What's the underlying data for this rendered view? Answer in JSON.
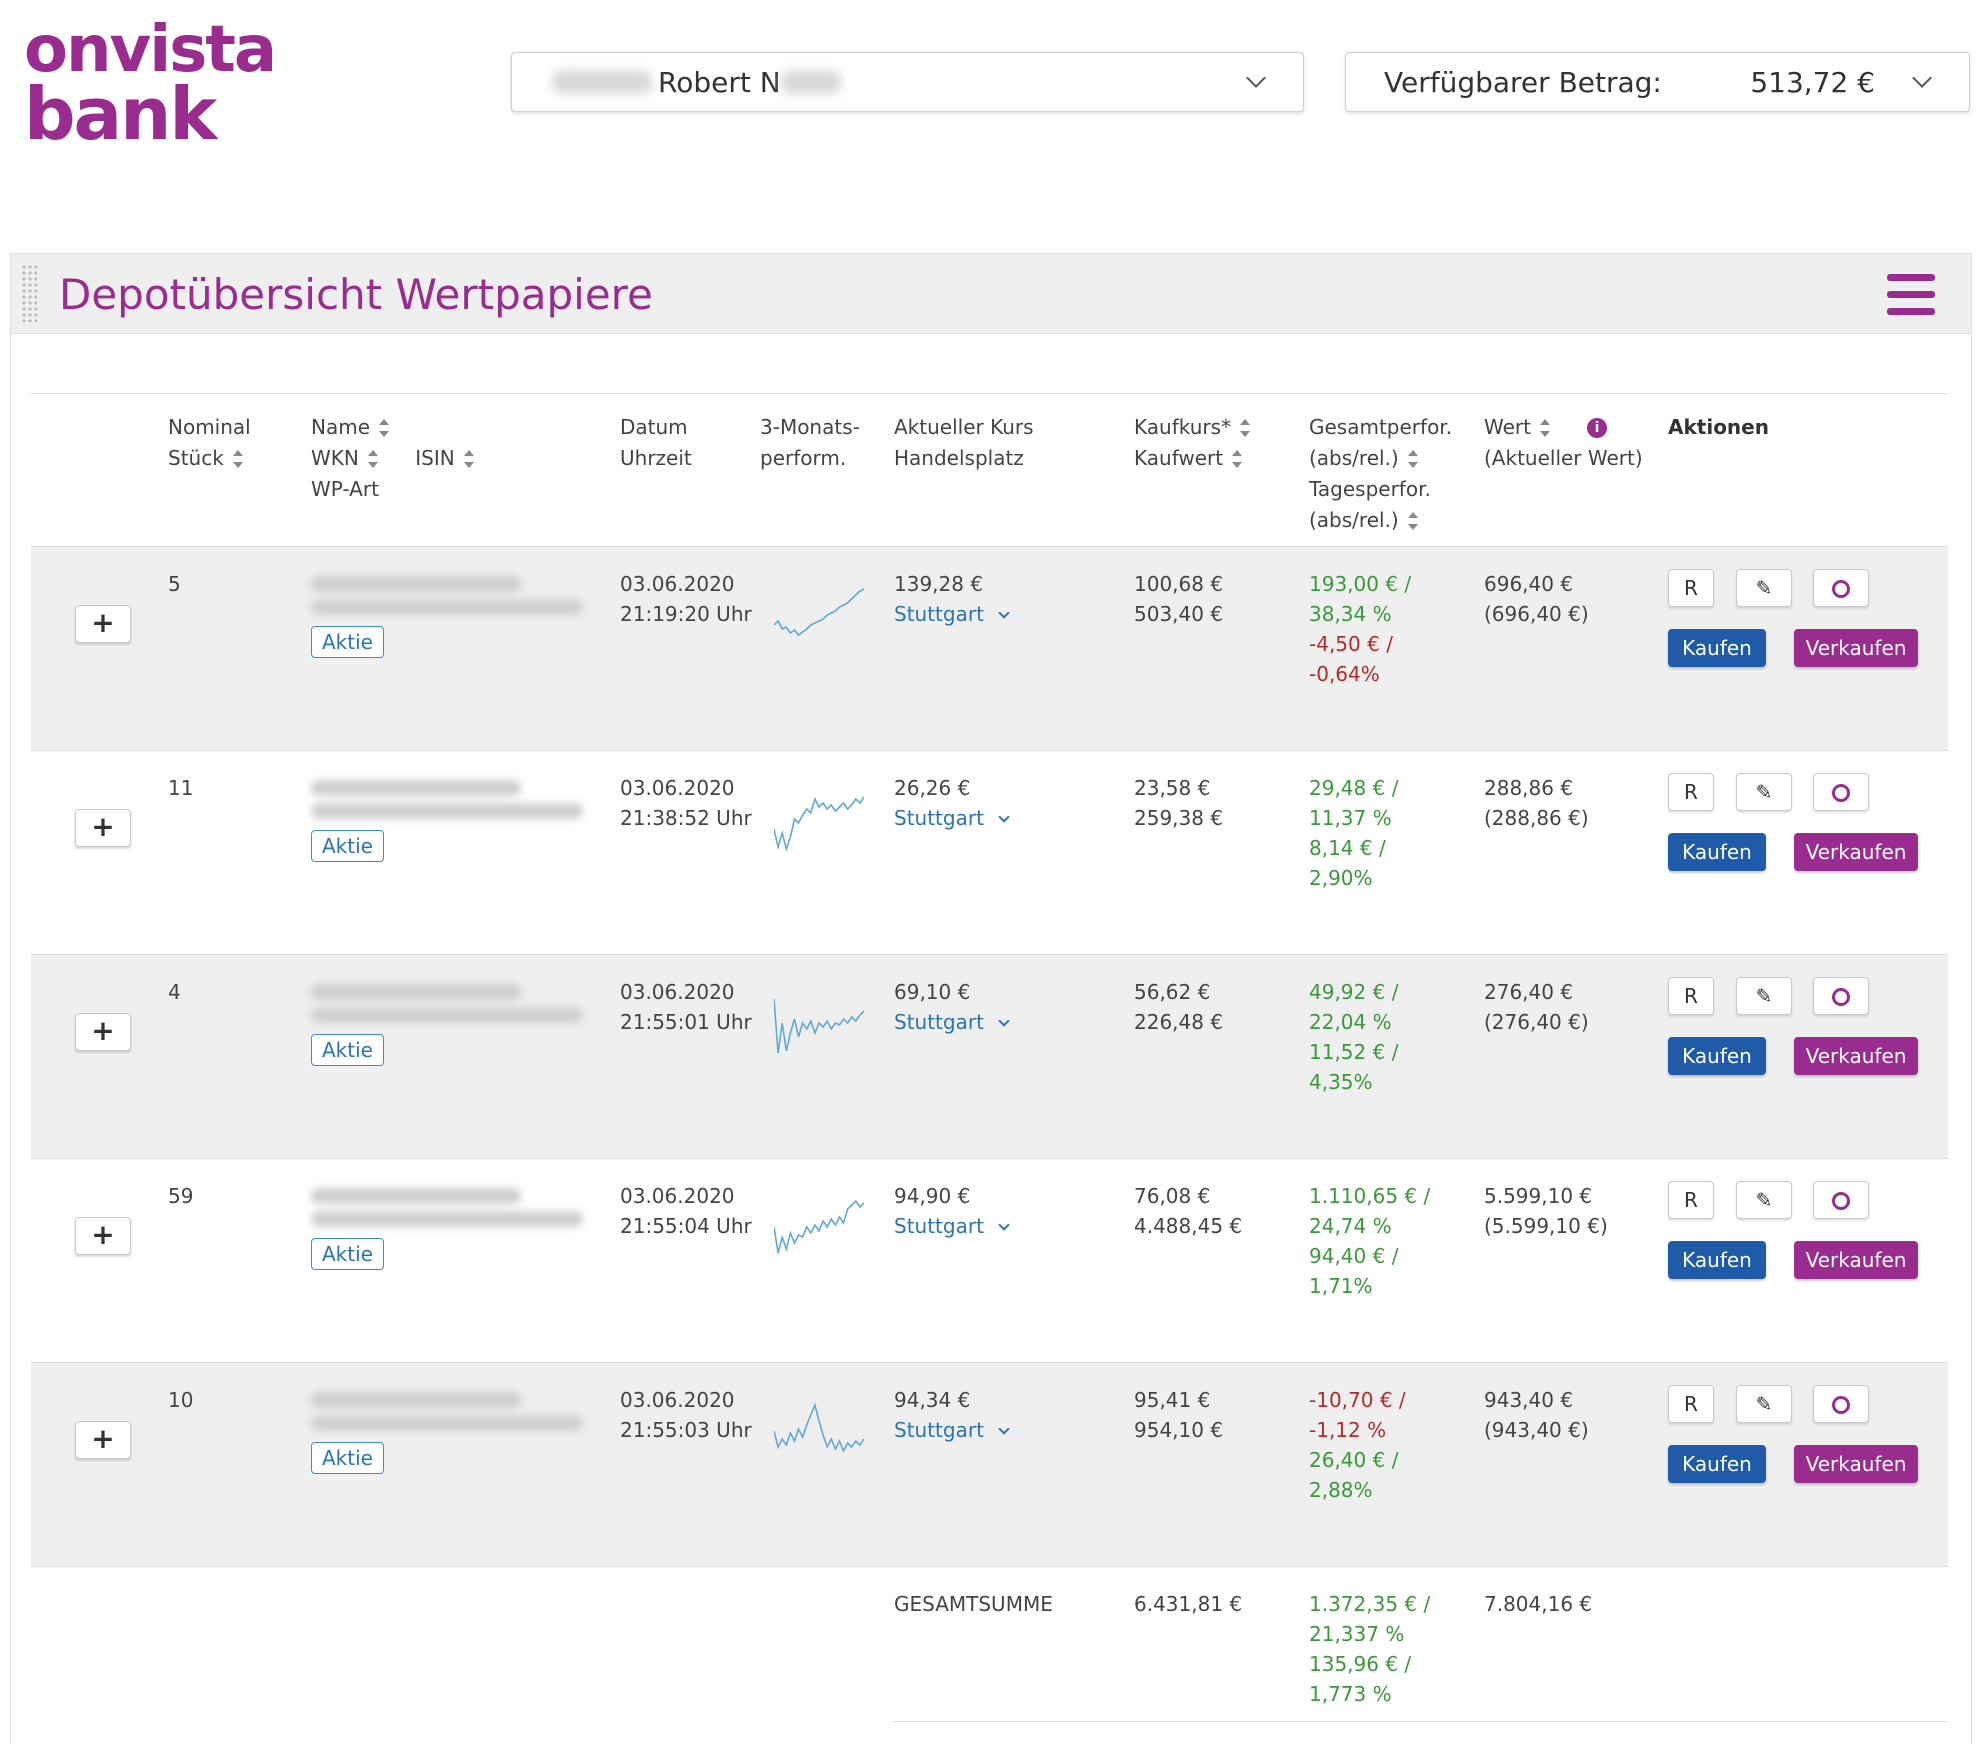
{
  "brand": {
    "line1": "onvista",
    "line2": "bank",
    "color": "#9a2c8f"
  },
  "account_selector": {
    "name": "Robert N"
  },
  "amount_selector": {
    "label": "Verfügbarer Betrag:",
    "value": "513,72 €"
  },
  "panel": {
    "title": "Depotübersicht Wertpapiere"
  },
  "columns": {
    "nominal": "Nominal",
    "stueck": "Stück",
    "name": "Name",
    "wkn": "WKN",
    "isin": "ISIN",
    "wpart": "WP-Art",
    "datum": "Datum",
    "uhrzeit": "Uhrzeit",
    "perf3m_1": "3-Monats-",
    "perf3m_2": "perform.",
    "kurs": "Aktueller Kurs",
    "handelsplatz": "Handelsplatz",
    "kaufkurs": "Kaufkurs*",
    "kaufwert": "Kaufwert",
    "gesamt": "Gesamtperfor.",
    "gesamt_abs": "(abs/rel.)",
    "tages": "Tagesperfor.",
    "tages_abs": "(abs/rel.)",
    "wert": "Wert",
    "wert_aktuell": "(Aktueller Wert)",
    "aktionen": "Aktionen"
  },
  "buttons": {
    "expand": "+",
    "r": "R",
    "edit": "✎",
    "buy": "Kaufen",
    "sell": "Verkaufen"
  },
  "rows": [
    {
      "stueck": "5",
      "wpart": "Aktie",
      "datum": "03.06.2020",
      "uhrzeit": "21:19:20 Uhr",
      "kurs": "139,28 €",
      "handelsplatz": "Stuttgart",
      "kaufkurs": "100,68 €",
      "kaufwert": "503,40 €",
      "gesamt_abs": "193,00 € /",
      "gesamt_rel": "38,34 %",
      "tages_abs": "-4,50 € /",
      "tages_rel": "-0,64%",
      "wert": "696,40 €",
      "wert_aktuell": "(696,40 €)",
      "spark": [
        40,
        36,
        44,
        42,
        48,
        45,
        50,
        47,
        44,
        40,
        38,
        36,
        34,
        30,
        28,
        26,
        22,
        20,
        18,
        14,
        10,
        6,
        4
      ]
    },
    {
      "stueck": "11",
      "wpart": "Aktie",
      "datum": "03.06.2020",
      "uhrzeit": "21:38:52 Uhr",
      "kurs": "26,26 €",
      "handelsplatz": "Stuttgart",
      "kaufkurs": "23,58 €",
      "kaufwert": "259,38 €",
      "gesamt_abs": "29,48 € /",
      "gesamt_rel": "11,37 %",
      "tages_abs": "8,14 € /",
      "tages_rel": "2,90%",
      "wert": "288,86 €",
      "wert_aktuell": "(288,86 €)",
      "spark": [
        40,
        58,
        44,
        60,
        48,
        30,
        34,
        26,
        20,
        24,
        10,
        18,
        14,
        20,
        16,
        22,
        18,
        14,
        20,
        16,
        10,
        14,
        8
      ]
    },
    {
      "stueck": "4",
      "wpart": "Aktie",
      "datum": "03.06.2020",
      "uhrzeit": "21:55:01 Uhr",
      "kurs": "69,10 €",
      "handelsplatz": "Stuttgart",
      "kaufkurs": "56,62 €",
      "kaufwert": "226,48 €",
      "gesamt_abs": "49,92 € /",
      "gesamt_rel": "22,04 %",
      "tages_abs": "11,52 € /",
      "tages_rel": "4,35%",
      "wert": "276,40 €",
      "wert_aktuell": "(276,40 €)",
      "spark": [
        6,
        60,
        30,
        58,
        40,
        26,
        44,
        30,
        36,
        28,
        40,
        30,
        34,
        28,
        36,
        30,
        32,
        26,
        30,
        24,
        28,
        22,
        18
      ]
    },
    {
      "stueck": "59",
      "wpart": "Aktie",
      "datum": "03.06.2020",
      "uhrzeit": "21:55:04 Uhr",
      "kurs": "94,90 €",
      "handelsplatz": "Stuttgart",
      "kaufkurs": "76,08 €",
      "kaufwert": "4.488,45 €",
      "gesamt_abs": "1.110,65 € /",
      "gesamt_rel": "24,74 %",
      "tages_abs": "94,40 € /",
      "tages_rel": "1,71%",
      "wert": "5.599,10 €",
      "wert_aktuell": "(5.599,10 €)",
      "spark": [
        30,
        56,
        40,
        52,
        36,
        46,
        38,
        40,
        30,
        36,
        28,
        34,
        24,
        30,
        22,
        28,
        20,
        26,
        12,
        8,
        4,
        10,
        6
      ]
    },
    {
      "stueck": "10",
      "wpart": "Aktie",
      "datum": "03.06.2020",
      "uhrzeit": "21:55:03 Uhr",
      "kurs": "94,34 €",
      "handelsplatz": "Stuttgart",
      "kaufkurs": "95,41 €",
      "kaufwert": "954,10 €",
      "gesamt_abs": "-10,70 € /",
      "gesamt_rel": "-1,12 %",
      "tages_abs": "26,40 € /",
      "tages_rel": "2,88%",
      "wert": "943,40 €",
      "wert_aktuell": "(943,40 €)",
      "spark": [
        30,
        46,
        38,
        44,
        32,
        40,
        28,
        36,
        24,
        14,
        4,
        20,
        34,
        46,
        38,
        48,
        40,
        50,
        42,
        46,
        40,
        44,
        38
      ]
    }
  ],
  "total": {
    "label": "GESAMTSUMME",
    "kaufwert": "6.431,81 €",
    "gesamt_abs": "1.372,35 € /",
    "gesamt_rel": "21,337 %",
    "tages_abs": "135,96 € /",
    "tages_rel": "1,773 %",
    "wert": "7.804,16 €"
  },
  "colors": {
    "accent": "#9a2c8f",
    "buy": "#1f5ba8",
    "positive": "#3a9a3a",
    "negative": "#b52a2a",
    "link": "#2a74b3",
    "spark": "#5fa8d8"
  }
}
